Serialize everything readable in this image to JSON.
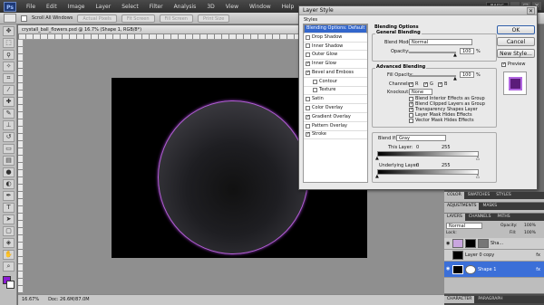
{
  "menubar": {
    "logo": "Ps",
    "items": [
      "File",
      "Edit",
      "Image",
      "Layer",
      "Select",
      "Filter",
      "Analysis",
      "3D",
      "View",
      "Window",
      "Help"
    ],
    "workspace": "BASIC"
  },
  "options_bar": {
    "scroll_all_label": "Scroll All Windows",
    "actual_pixels": "Actual Pixels",
    "fit_screen": "Fit Screen",
    "fill_screen": "Fill Screen",
    "print_size": "Print Size"
  },
  "document": {
    "tab_title": "crystall_ball_flowers.psd @ 16.7% (Shape 1, RGB/8*)",
    "zoom": "16.67%",
    "doc_size": "Doc: 26.6M/87.0M"
  },
  "colors": {
    "foreground": "#8a1bd4",
    "background": "#ffffff",
    "orb_stroke": "#b35fd6"
  },
  "dialog": {
    "title": "Layer Style",
    "styles_header": "Styles",
    "styles": [
      {
        "label": "Blending Options: Default",
        "checked": false,
        "selected": true,
        "sub": false
      },
      {
        "label": "Drop Shadow",
        "checked": false,
        "selected": false,
        "sub": false
      },
      {
        "label": "Inner Shadow",
        "checked": false,
        "selected": false,
        "sub": false
      },
      {
        "label": "Outer Glow",
        "checked": false,
        "selected": false,
        "sub": false
      },
      {
        "label": "Inner Glow",
        "checked": true,
        "selected": false,
        "sub": false
      },
      {
        "label": "Bevel and Emboss",
        "checked": true,
        "selected": false,
        "sub": false
      },
      {
        "label": "Contour",
        "checked": false,
        "selected": false,
        "sub": true
      },
      {
        "label": "Texture",
        "checked": false,
        "selected": false,
        "sub": true
      },
      {
        "label": "Satin",
        "checked": false,
        "selected": false,
        "sub": false
      },
      {
        "label": "Color Overlay",
        "checked": false,
        "selected": false,
        "sub": false
      },
      {
        "label": "Gradient Overlay",
        "checked": true,
        "selected": false,
        "sub": false
      },
      {
        "label": "Pattern Overlay",
        "checked": false,
        "selected": false,
        "sub": false
      },
      {
        "label": "Stroke",
        "checked": true,
        "selected": false,
        "sub": false
      }
    ],
    "blending_options_label": "Blending Options",
    "general_blending_label": "General Blending",
    "blend_mode_label": "Blend Mode:",
    "blend_mode_value": "Normal",
    "opacity_label": "Opacity:",
    "opacity_value": "100",
    "percent": "%",
    "advanced_blending_label": "Advanced Blending",
    "fill_opacity_label": "Fill Opacity:",
    "fill_opacity_value": "100",
    "channels_label": "Channels:",
    "channel_r": "R",
    "channel_g": "G",
    "channel_b": "B",
    "knockout_label": "Knockout:",
    "knockout_value": "None",
    "adv_checks": [
      {
        "label": "Blend Interior Effects as Group",
        "checked": false
      },
      {
        "label": "Blend Clipped Layers as Group",
        "checked": true
      },
      {
        "label": "Transparency Shapes Layer",
        "checked": true
      },
      {
        "label": "Layer Mask Hides Effects",
        "checked": false
      },
      {
        "label": "Vector Mask Hides Effects",
        "checked": false
      }
    ],
    "blend_if_label": "Blend If:",
    "blend_if_value": "Gray",
    "this_layer_label": "This Layer:",
    "underlying_label": "Underlying Layer:",
    "range_min": "0",
    "range_max": "255",
    "ok": "OK",
    "cancel": "Cancel",
    "new_style": "New Style...",
    "preview_label": "Preview"
  },
  "panels": {
    "tabs1": [
      "COLOR",
      "SWATCHES",
      "STYLES"
    ],
    "tabs2": [
      "ADJUSTMENTS",
      "MASKS"
    ],
    "tabs3": [
      "LAYERS",
      "CHANNELS",
      "PATHS"
    ],
    "blend_mode": "Normal",
    "opacity_label": "Opacity:",
    "opacity_value": "100%",
    "fill_label": "Fill:",
    "fill_value": "100%",
    "lock_label": "Lock:",
    "layers": [
      {
        "name": "Sha...",
        "active": false
      },
      {
        "name": "Layer 0 copy",
        "active": false
      },
      {
        "name": "Shape 1",
        "active": true
      }
    ],
    "fx": "fx",
    "tabs_bottom": [
      "CHARACTER",
      "PARAGRAPH"
    ]
  }
}
